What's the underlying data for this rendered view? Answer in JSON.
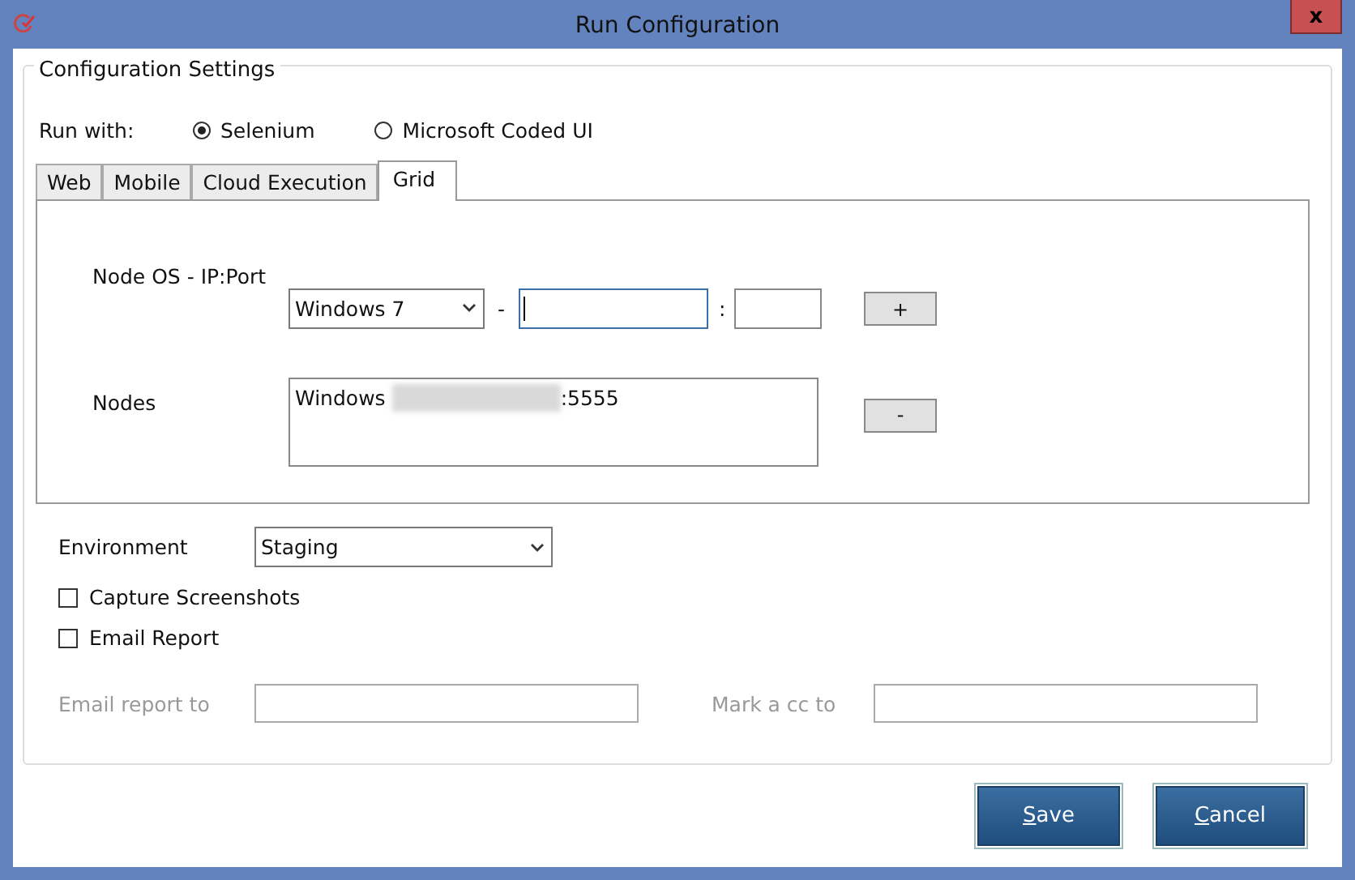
{
  "window": {
    "title": "Run Configuration",
    "close": "x"
  },
  "group": {
    "title": "Configuration Settings"
  },
  "run_with": {
    "label": "Run with:",
    "options": [
      {
        "label": "Selenium",
        "selected": true
      },
      {
        "label": "Microsoft Coded UI",
        "selected": false
      }
    ]
  },
  "tabs": [
    {
      "label": "Web",
      "selected": false
    },
    {
      "label": "Mobile",
      "selected": false
    },
    {
      "label": "Cloud Execution",
      "selected": false
    },
    {
      "label": "Grid",
      "selected": true
    }
  ],
  "grid": {
    "node_label": "Node OS - IP:Port",
    "os_value": "Windows 7",
    "dash": "-",
    "colon": ":",
    "add": "+",
    "nodes_label": "Nodes",
    "remove": "-",
    "nodes": [
      {
        "prefix": "Windows",
        "suffix": ":5555",
        "redacted": true
      }
    ]
  },
  "environment": {
    "label": "Environment",
    "value": "Staging"
  },
  "checkboxes": [
    {
      "label": "Capture Screenshots",
      "checked": false
    },
    {
      "label": "Email Report",
      "checked": false
    }
  ],
  "email_fields": [
    {
      "label": "Email report to",
      "disabled": true
    },
    {
      "label": "Mark a cc to",
      "disabled": true
    }
  ],
  "buttons": [
    {
      "label": "Save"
    },
    {
      "label": "Cancel"
    }
  ]
}
